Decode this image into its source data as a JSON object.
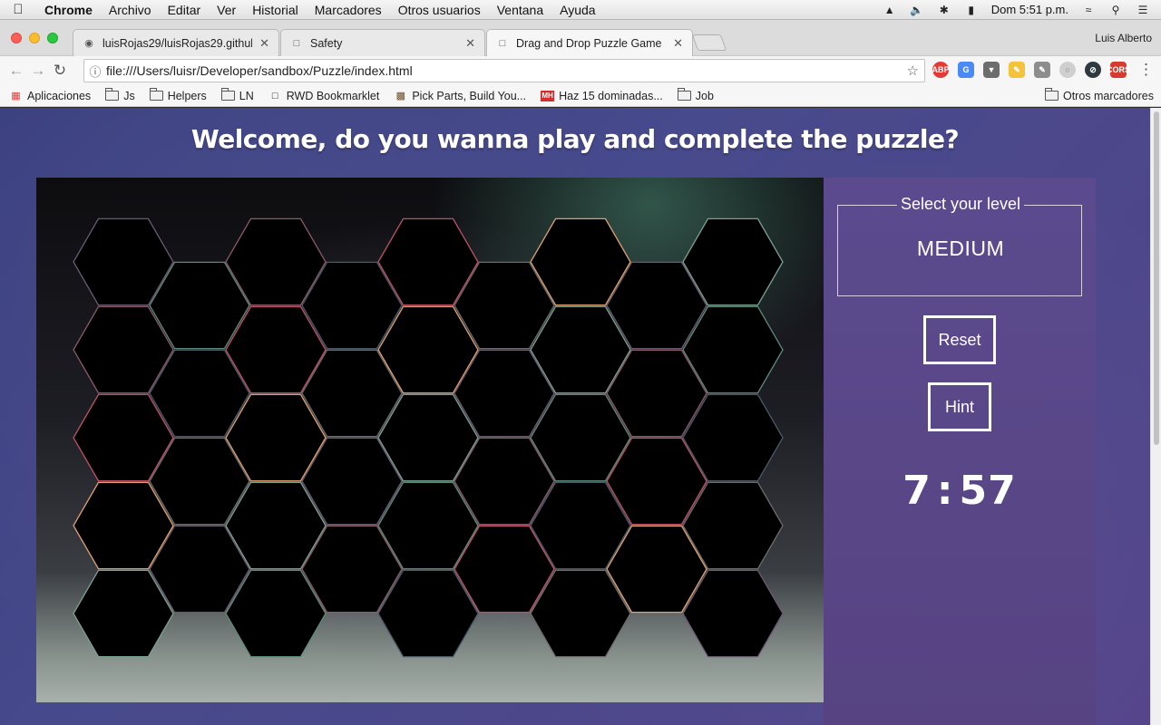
{
  "menubar": {
    "app": "Chrome",
    "items": [
      "Archivo",
      "Editar",
      "Ver",
      "Historial",
      "Marcadores",
      "Otros usuarios",
      "Ventana",
      "Ayuda"
    ],
    "clock": "Dom 5:51 p.m."
  },
  "tabs": [
    {
      "title": "luisRojas29/luisRojas29.github.",
      "icon": "github-icon"
    },
    {
      "title": "Safety",
      "icon": "page-icon"
    },
    {
      "title": "Drag and Drop Puzzle Game",
      "icon": "page-icon"
    }
  ],
  "profile_name": "Luis Alberto",
  "address": "file:///Users/luisr/Developer/sandbox/Puzzle/index.html",
  "bookmarks": [
    {
      "label": "Aplicaciones",
      "icon": "apps-icon"
    },
    {
      "label": "Js",
      "icon": "folder-icon"
    },
    {
      "label": "Helpers",
      "icon": "folder-icon"
    },
    {
      "label": "LN",
      "icon": "folder-icon"
    },
    {
      "label": "RWD Bookmarklet",
      "icon": "page-icon"
    },
    {
      "label": "Pick Parts, Build You...",
      "icon": "box-icon"
    },
    {
      "label": "Haz 15  dominadas...",
      "icon": "mh-icon"
    },
    {
      "label": "Job",
      "icon": "folder-icon"
    }
  ],
  "bookmarks_other": "Otros marcadores",
  "page": {
    "title": "Welcome, do you wanna play and complete the puzzle?",
    "level_legend": "Select your level",
    "level_value": "MEDIUM",
    "reset_label": "Reset",
    "hint_label": "Hint",
    "timer_minutes": "7",
    "timer_sep": ":",
    "timer_seconds": "57"
  },
  "colors": {
    "page_bg": "#474a8c",
    "panel_bg": "#5b4b8e",
    "hex_fill": "#000000"
  }
}
